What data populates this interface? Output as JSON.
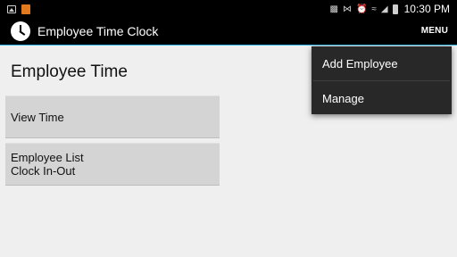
{
  "status_bar": {
    "time": "10:30 PM",
    "icons": [
      "image-icon",
      "app-notification-icon",
      "lock-icon",
      "bluetooth-icon",
      "alarm-icon",
      "wifi-icon",
      "signal-icon",
      "battery-icon"
    ]
  },
  "action_bar": {
    "title": "Employee Time Clock",
    "menu_label": "MENU"
  },
  "main": {
    "page_title": "Employee Time",
    "tiles": [
      {
        "lines": [
          "View Time"
        ]
      },
      {
        "lines": [
          "Employee List",
          "Clock In-Out"
        ]
      }
    ]
  },
  "overflow_menu": {
    "items": [
      {
        "label": "Add Employee"
      },
      {
        "label": "Manage"
      }
    ]
  },
  "colors": {
    "accent": "#33b5e5",
    "action_bar_bg": "#000000",
    "tile_bg": "#d4d4d4",
    "menu_bg": "#282828"
  }
}
